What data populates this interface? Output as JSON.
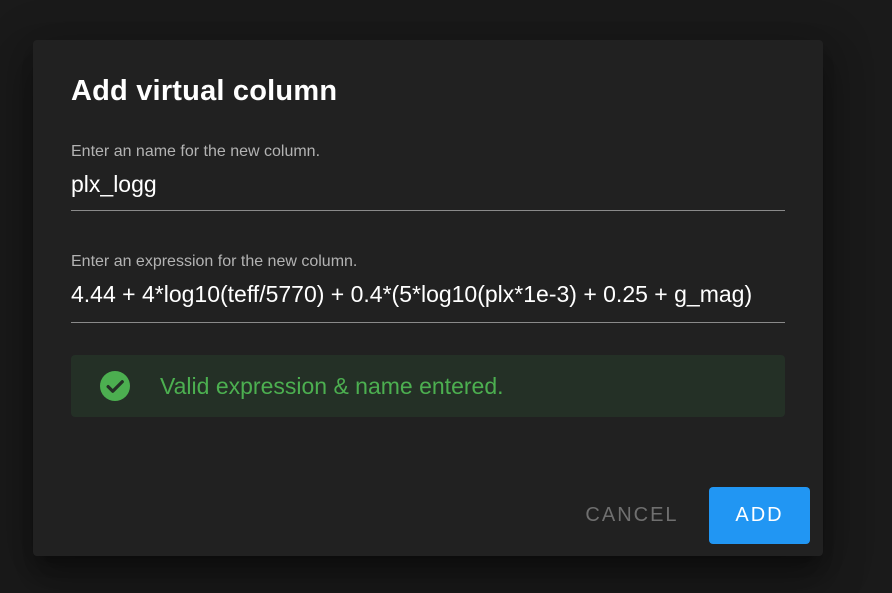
{
  "dialog": {
    "title": "Add virtual column",
    "name_field": {
      "label": "Enter an name for the new column.",
      "value": "plx_logg"
    },
    "expression_field": {
      "label": "Enter an expression for the new column.",
      "value": "4.44 + 4*log10(teff/5770) + 0.4*(5*log10(plx*1e-3) + 0.25 + g_mag)"
    },
    "alert": {
      "icon": "check-circle-icon",
      "text": "Valid expression & name entered.",
      "color": "#4caf50"
    },
    "actions": {
      "cancel_label": "Cancel",
      "add_label": "Add"
    }
  },
  "colors": {
    "accent": "#2196f3",
    "success": "#4caf50",
    "surface": "#212121"
  }
}
